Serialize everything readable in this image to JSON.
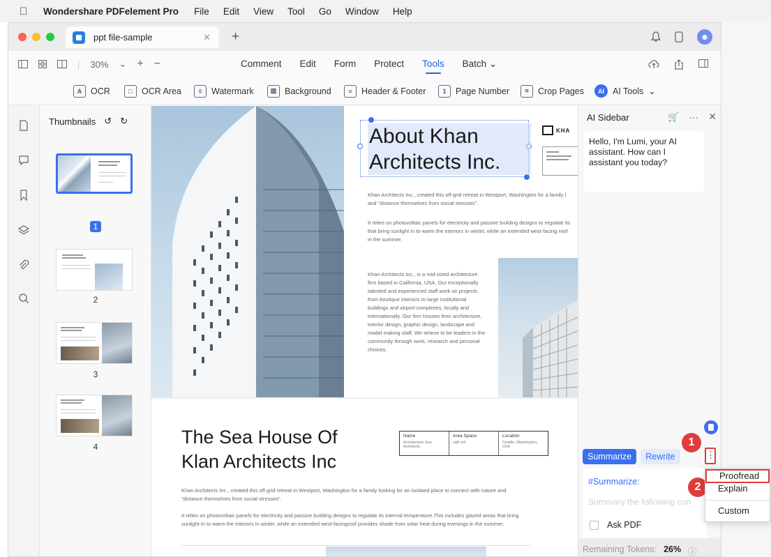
{
  "menubar": {
    "app_name": "Wondershare PDFelement Pro",
    "items": [
      "File",
      "Edit",
      "View",
      "Tool",
      "Go",
      "Window",
      "Help"
    ]
  },
  "tab": {
    "title": "ppt file-sample"
  },
  "toolbar": {
    "zoom": "30%",
    "tabs": [
      "Comment",
      "Edit",
      "Form",
      "Protect",
      "Tools",
      "Batch"
    ],
    "active_tab": "Tools",
    "tools": [
      "OCR",
      "OCR Area",
      "Watermark",
      "Background",
      "Header & Footer",
      "Page Number",
      "Crop Pages",
      "AI Tools"
    ]
  },
  "thumbnails": {
    "title": "Thumbnails",
    "pages": [
      "1",
      "2",
      "3",
      "4"
    ],
    "selected_page": "1"
  },
  "document": {
    "page1": {
      "title": "About Khan Architects Inc.",
      "logo_text": "KHA",
      "intro_lines": [
        "Khan Architects Inc., created this off-grid retreat in Westport, Washington for a family l",
        "and \"distance themselves from social stresses\".",
        "It relies on photovoltaic panels for electricity and passive building designs to regulate its",
        "that bring sunlight in to warm the interiors in winter, while an extended west-facing roof",
        "in the summer."
      ],
      "body_lines": [
        "Khan Architects Inc., is a mid-sized architecture",
        "firm based in California, USA. Our exceptionally",
        "talented and experienced staff work on projects",
        "from boutique interiors to large institutional",
        "buildings and airport complexes, locally and",
        "internationally. Our firm houses their architecture,",
        "interior design, graphic design, landscape and",
        "model making staff. We strieve to be leaders in the",
        "community through work, research and personal",
        "choices."
      ]
    },
    "page2": {
      "title_line1": "The Sea House Of",
      "title_line2": "Klan Architects Inc",
      "table": [
        {
          "head": "Name",
          "sub": "Architecture Gas Architects"
        },
        {
          "head": "Area Space",
          "sub": "sqft ord"
        },
        {
          "head": "Location",
          "sub": "Seattle, Washington, USA"
        }
      ],
      "lines": [
        "Khan Architects Inc., created this off-grid retreat in Westport, Washington for a family looking for an isolated place to connect with nature and",
        "\"distance themselves from social stresses\".",
        "It relies on photovoltaic panels for electricity and passive building designs to regulate its internal temperature.This includes glazed areas that bring",
        "sunlight in to warm the interiors in winter, while an extended west-facingroof provides shade from solar heat during evenings in the summer."
      ]
    }
  },
  "ai_sidebar": {
    "title": "AI Sidebar",
    "greeting": "Hello, I'm Lumi, your AI assistant. How can I assistant you today?",
    "pill_active": "Summarize",
    "pill_other": "Rewrite",
    "input_label": "#Summarize:",
    "input_placeholder": "Summary the following con",
    "ask_pdf": "Ask PDF",
    "tokens_label": "Remaining Tokens:",
    "tokens_value": "26%"
  },
  "context_menu": {
    "items": [
      "Proofread",
      "Explain",
      "Custom"
    ],
    "highlighted": "Proofread"
  },
  "callouts": [
    "1",
    "2"
  ],
  "colors": {
    "accent": "#3b6ff0",
    "callout": "#e03c3c"
  }
}
